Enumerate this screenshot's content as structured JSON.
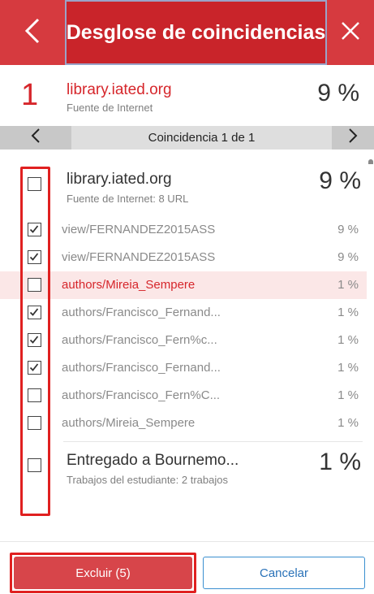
{
  "header": {
    "title": "Desglose de coincidencias",
    "back_icon": "chevron-left-icon",
    "close_icon": "close-icon",
    "colors": {
      "bar": "#d63a3f",
      "title_bg": "#c9242a"
    }
  },
  "summary": {
    "index": "1",
    "name": "library.iated.org",
    "type": "Fuente de Internet",
    "percent": "9 %"
  },
  "navigator": {
    "label": "Coincidencia 1 de 1",
    "prev_icon": "chevron-left-icon",
    "next_icon": "chevron-right-icon"
  },
  "sources": [
    {
      "name": "library.iated.org",
      "detail": "Fuente de Internet: 8 URL",
      "percent": "9 %",
      "checked": false,
      "items": [
        {
          "label": "view/FERNANDEZ2015ASS",
          "percent": "9 %",
          "checked": true,
          "highlighted": false
        },
        {
          "label": "view/FERNANDEZ2015ASS",
          "percent": "9 %",
          "checked": true,
          "highlighted": false
        },
        {
          "label": "authors/Mireia_Sempere",
          "percent": "1 %",
          "checked": false,
          "highlighted": true
        },
        {
          "label": "authors/Francisco_Fernand...",
          "percent": "1 %",
          "checked": true,
          "highlighted": false
        },
        {
          "label": "authors/Francisco_Fern%c...",
          "percent": "1 %",
          "checked": true,
          "highlighted": false
        },
        {
          "label": "authors/Francisco_Fernand...",
          "percent": "1 %",
          "checked": true,
          "highlighted": false
        },
        {
          "label": "authors/Francisco_Fern%C...",
          "percent": "1 %",
          "checked": false,
          "highlighted": false
        },
        {
          "label": "authors/Mireia_Sempere",
          "percent": "1 %",
          "checked": false,
          "highlighted": false
        }
      ]
    },
    {
      "name": "Entregado a Bournemo...",
      "detail": "Trabajos del estudiante: 2 trabajos",
      "percent": "1 %",
      "checked": false,
      "items": []
    }
  ],
  "footer": {
    "exclude_label": "Excluir (5)",
    "cancel_label": "Cancelar",
    "colors": {
      "exclude_bg": "#d7454a",
      "cancel_border": "#3a8fd0"
    }
  },
  "annotation_color": "#e02020"
}
